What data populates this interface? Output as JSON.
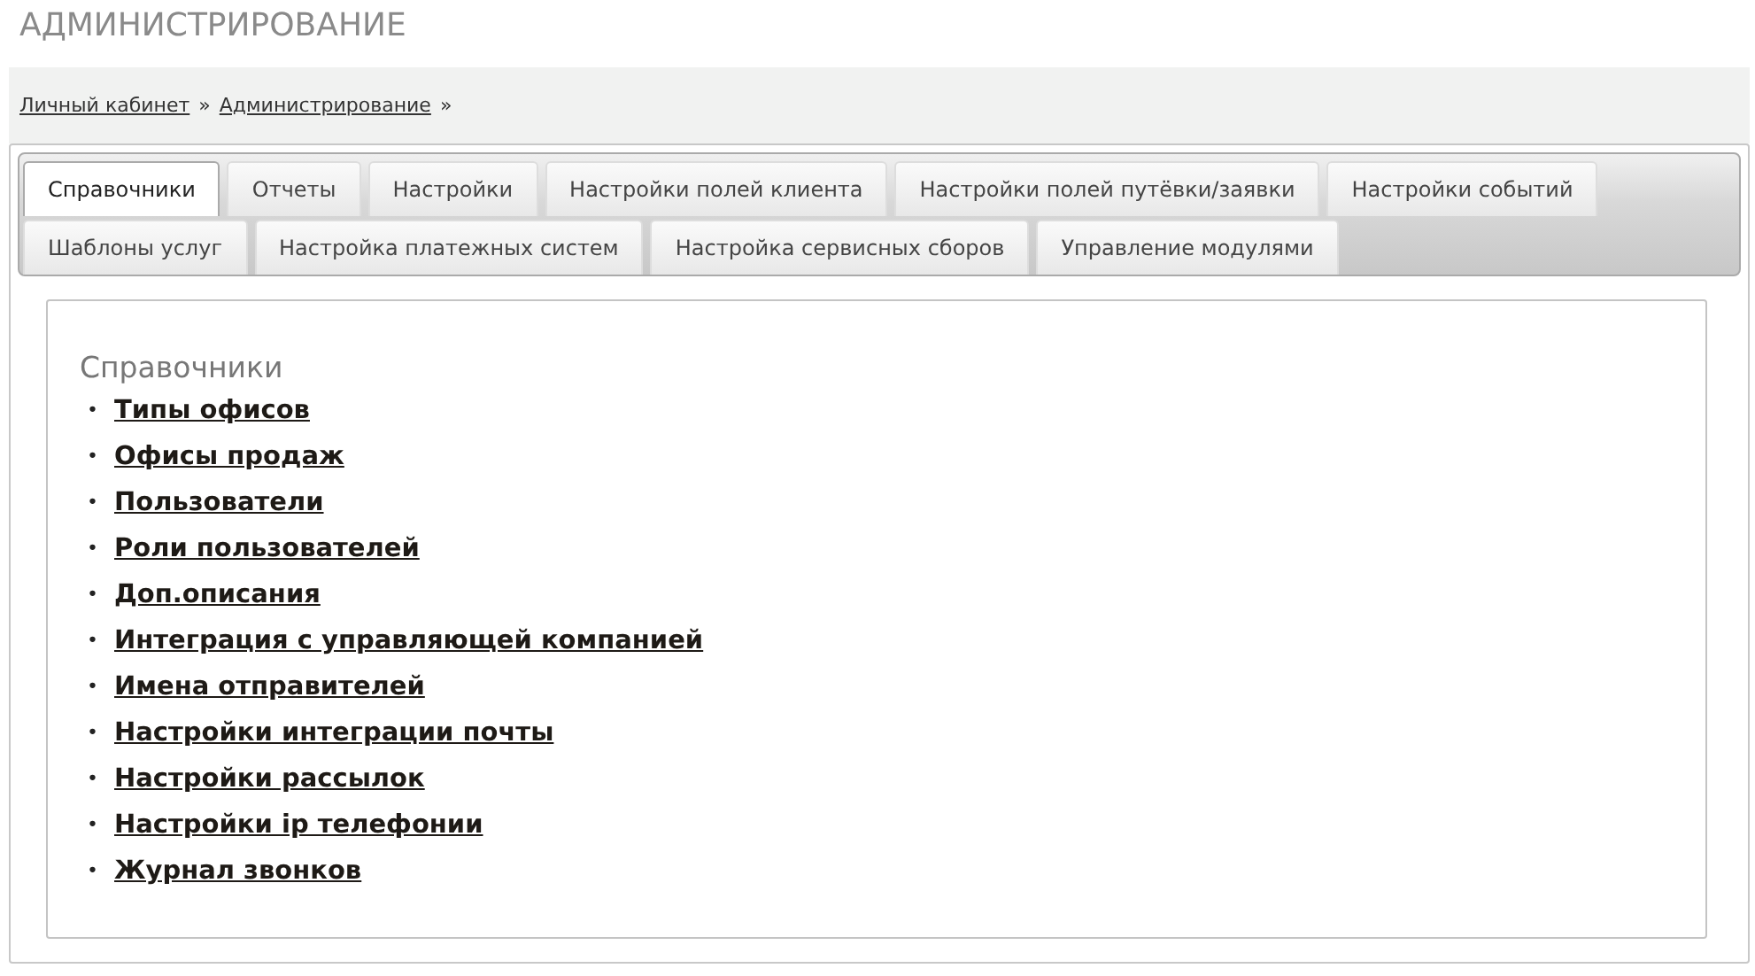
{
  "page_title": "АДМИНИСТРИРОВАНИЕ",
  "breadcrumbs": [
    {
      "label": "Личный кабинет",
      "separator": "»"
    },
    {
      "label": "Администрирование",
      "separator": "»"
    }
  ],
  "tab_rows": [
    [
      {
        "label": "Справочники",
        "selected": true
      },
      {
        "label": "Отчеты",
        "selected": false
      },
      {
        "label": "Настройки",
        "selected": false
      },
      {
        "label": "Настройки полей клиента",
        "selected": false
      },
      {
        "label": "Настройки полей путёвки/заявки",
        "selected": false
      },
      {
        "label": "Настройки событий",
        "selected": false
      }
    ],
    [
      {
        "label": "Шаблоны услуг",
        "selected": false
      },
      {
        "label": "Настройка платежных систем",
        "selected": false
      },
      {
        "label": "Настройка сервисных сборов",
        "selected": false
      },
      {
        "label": "Управление модулями",
        "selected": false
      }
    ]
  ],
  "section": {
    "title": "Справочники",
    "links": [
      {
        "bullet": "•",
        "label": "Типы офисов"
      },
      {
        "bullet": "•",
        "label": "Офисы продаж"
      },
      {
        "bullet": "•",
        "label": "Пользователи"
      },
      {
        "bullet": "•",
        "label": "Роли пользователей"
      },
      {
        "bullet": "•",
        "label": "Доп.описания"
      },
      {
        "bullet": "•",
        "label": "Интеграция с управляющей компанией"
      },
      {
        "bullet": "•",
        "label": "Имена отправителей"
      },
      {
        "bullet": "•",
        "label": "Настройки интеграции почты"
      },
      {
        "bullet": "•",
        "label": "Настройки рассылок"
      },
      {
        "bullet": "•",
        "label": "Настройки ip телефонии"
      },
      {
        "bullet": "•",
        "label": "Журнал звонков"
      }
    ]
  }
}
